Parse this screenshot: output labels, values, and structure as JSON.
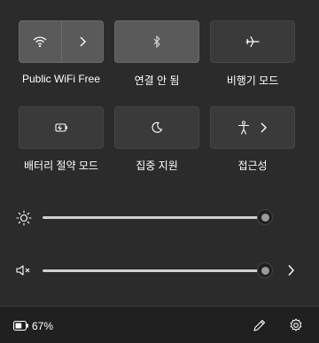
{
  "tiles": {
    "wifi": {
      "label": "Public WiFi Free",
      "icon": "wifi-icon",
      "expand_icon": "chevron-right-icon",
      "active": true
    },
    "bluetooth": {
      "label": "연결 안 됨",
      "icon": "bluetooth-icon",
      "active": true
    },
    "airplane": {
      "label": "비행기 모드",
      "icon": "airplane-icon",
      "active": false
    },
    "battery_saver": {
      "label": "배터리 절약 모드",
      "icon": "battery-saver-icon",
      "active": false
    },
    "focus_assist": {
      "label": "집중 지원",
      "icon": "moon-icon",
      "active": false
    },
    "accessibility": {
      "label": "접근성",
      "icon": "accessibility-icon",
      "expand_icon": "chevron-right-icon",
      "active": false
    }
  },
  "brightness": {
    "icon": "brightness-icon",
    "value": 1.0
  },
  "volume": {
    "icon": "volume-muted-icon",
    "value": 1.0,
    "expand_icon": "chevron-right-icon"
  },
  "footer": {
    "battery_icon": "battery-icon",
    "battery_text": "67%",
    "battery_level": 0.67,
    "edit_icon": "pencil-icon",
    "settings_icon": "gear-icon"
  },
  "colors": {
    "panel_bg": "#2b2b2b",
    "footer_bg": "#202020",
    "tile_bg": "#3a3a3a",
    "tile_active_bg": "#5a5a5a",
    "track": "#d0d0d0"
  }
}
